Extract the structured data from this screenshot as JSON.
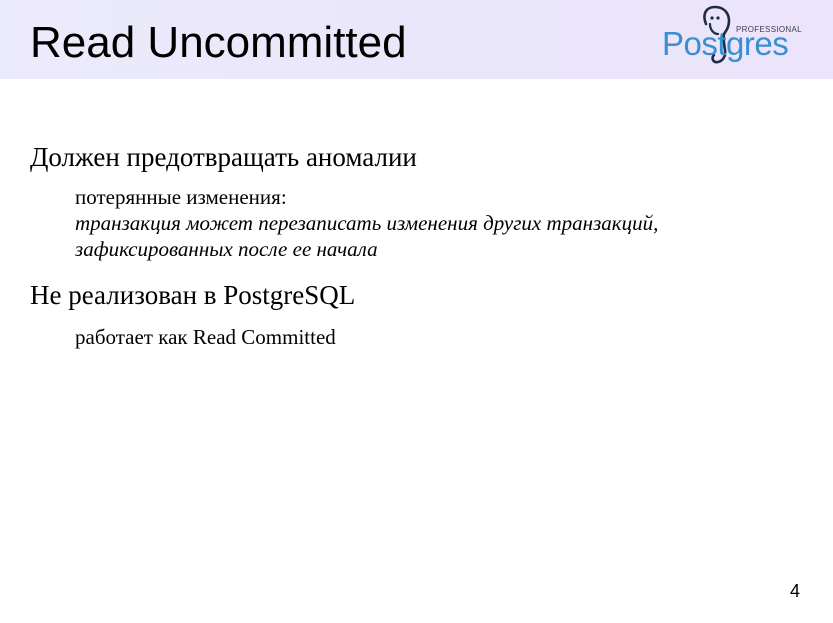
{
  "slide": {
    "title": "Read Uncommitted",
    "page_number": "4"
  },
  "logo": {
    "tagline": "PROFESSIONAL",
    "wordmark": "Postgres",
    "icon": "elephant-icon",
    "color": "#3a8fd3"
  },
  "sections": [
    {
      "heading": "Должен предотвращать аномалии",
      "lines": [
        "потерянные изменения:",
        "транзакция может перезаписать изменения других транзакций,",
        "зафиксированных после ее начала"
      ]
    },
    {
      "heading": "Не реализован в PostgreSQL",
      "lines": [
        "работает как Read Committed"
      ]
    }
  ]
}
